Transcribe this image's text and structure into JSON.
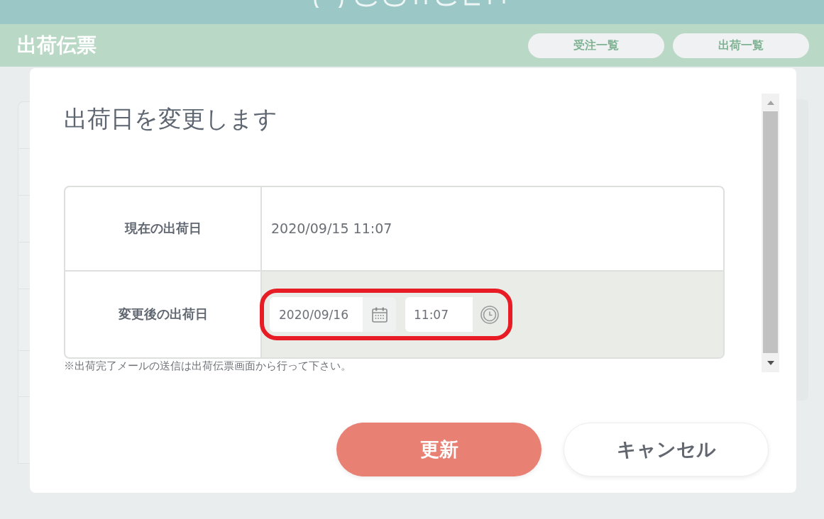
{
  "header": {
    "title": "出荷伝票",
    "nav_buttons": [
      {
        "label": "受注一覧"
      },
      {
        "label": "出荷一覧"
      }
    ]
  },
  "dialog": {
    "title": "出荷日を変更します",
    "rows": [
      {
        "kind": "text",
        "label": "現在の出荷日",
        "value": "2020/09/15 11:07"
      },
      {
        "kind": "datetime",
        "label": "変更後の出荷日",
        "date": "2020/09/16",
        "time": "11:07"
      }
    ],
    "note": "※出荷完了メールの送信は出荷伝票画面から行って下さい。",
    "buttons": [
      {
        "kind": "primary",
        "label": "更新"
      },
      {
        "kind": "secondary",
        "label": "キャンセル"
      }
    ]
  }
}
